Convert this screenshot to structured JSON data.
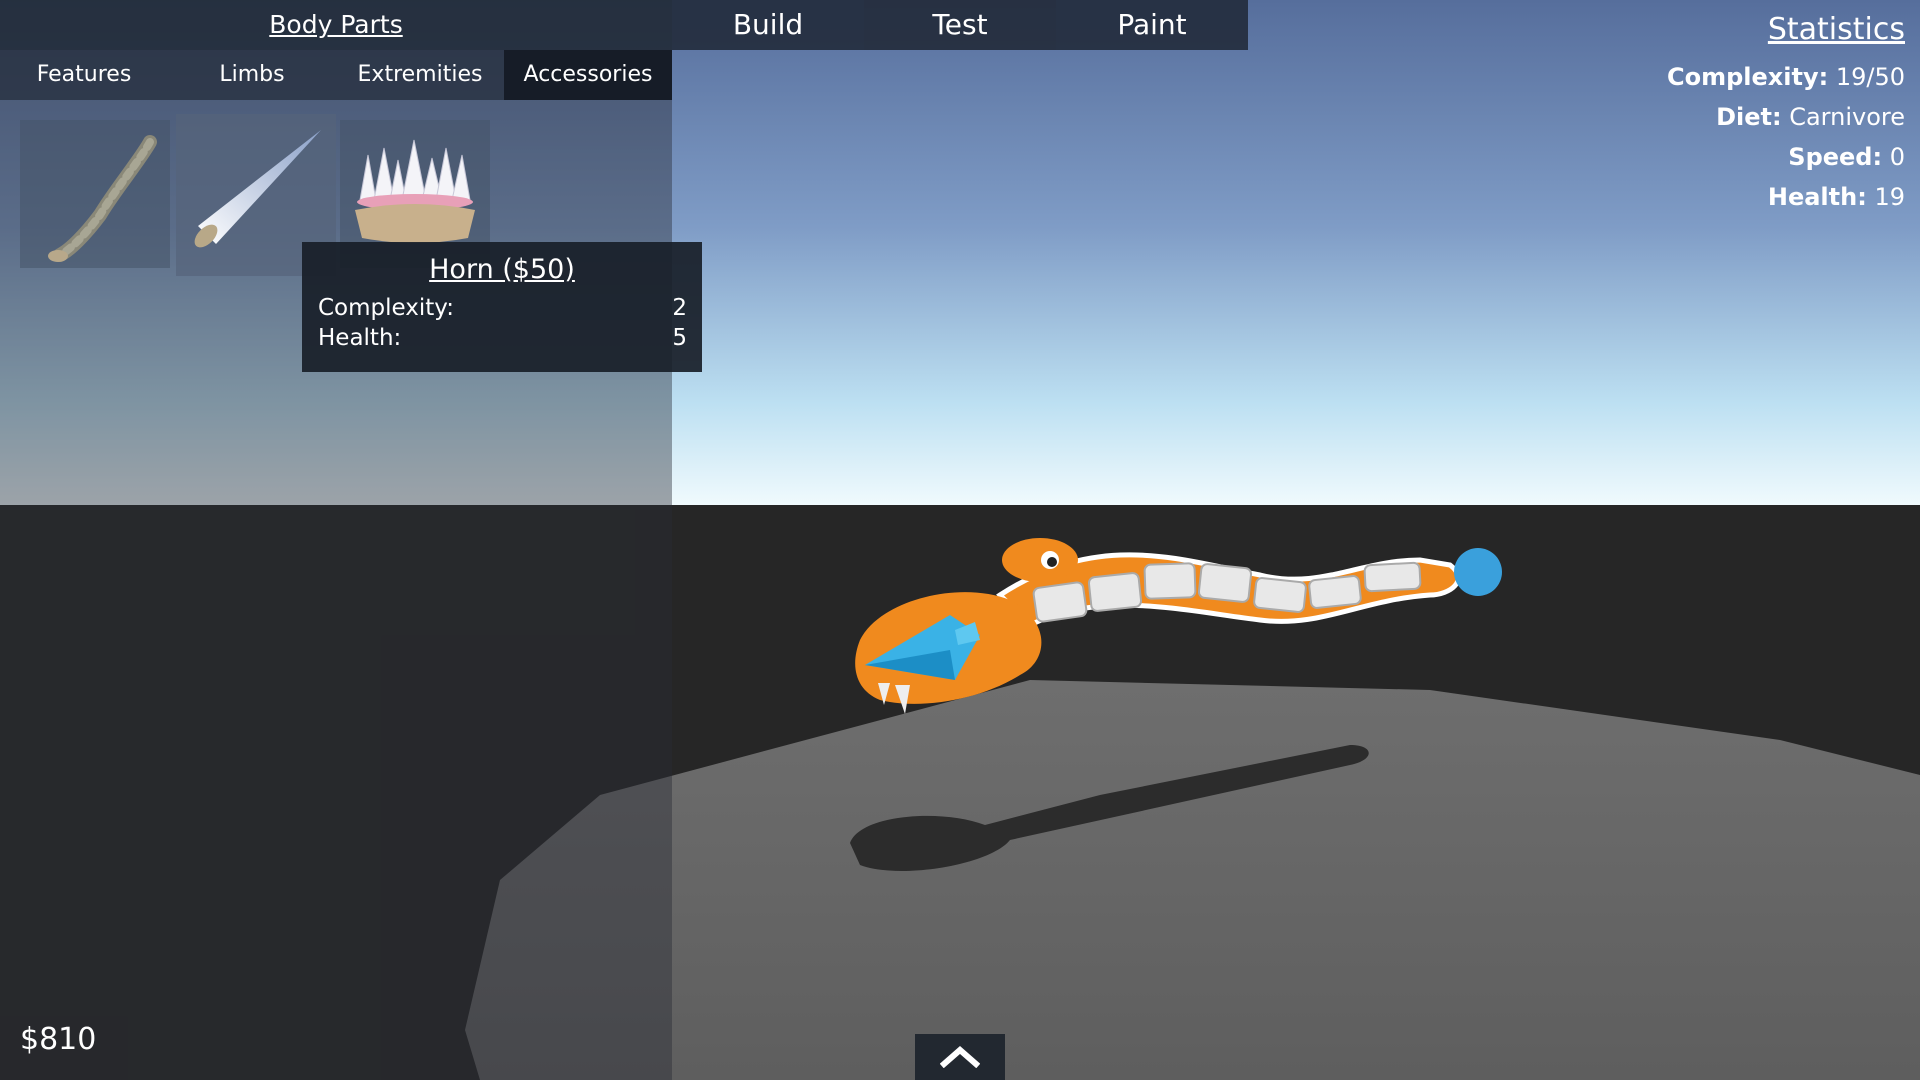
{
  "left_panel": {
    "title": "Body Parts",
    "tabs": [
      "Features",
      "Limbs",
      "Extremities",
      "Accessories"
    ],
    "active_tab": "Accessories",
    "parts": [
      {
        "icon": "tail-icon"
      },
      {
        "icon": "horn-icon"
      },
      {
        "icon": "spikes-icon"
      }
    ]
  },
  "tooltip": {
    "title": "Horn ($50)",
    "rows": [
      {
        "label": "Complexity:",
        "value": "2"
      },
      {
        "label": "Health:",
        "value": "5"
      }
    ]
  },
  "mode_tabs": [
    "Build",
    "Test",
    "Paint"
  ],
  "active_mode": "Test",
  "statistics": {
    "title": "Statistics",
    "items": [
      {
        "label": "Complexity:",
        "value": "19/50"
      },
      {
        "label": "Diet:",
        "value": "Carnivore"
      },
      {
        "label": "Speed:",
        "value": "0"
      },
      {
        "label": "Health:",
        "value": "19"
      }
    ]
  },
  "money": "$810",
  "expand_icon": "chevron-up-icon",
  "colors": {
    "creature": "#f08a1e",
    "horn": "#3aaee0",
    "sky_top": "#5b74a0",
    "sky_horizon": "#e8f6fc",
    "ground": "#2a2a2a",
    "platform": "#6a6a6a"
  }
}
